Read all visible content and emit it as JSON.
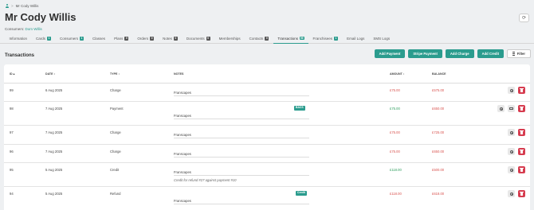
{
  "breadcrumb": {
    "separator": ">",
    "current": "Mr Cody Willis"
  },
  "page_title": "Mr Cody Willis",
  "consumers": {
    "label": "Consumers:",
    "link": "Dom Willis"
  },
  "tabs": [
    {
      "label": "Information",
      "badge": ""
    },
    {
      "label": "Cards",
      "badge": "1",
      "badge_color": "teal"
    },
    {
      "label": "Consumers",
      "badge": "1",
      "badge_color": "teal"
    },
    {
      "label": "Classes",
      "badge": ""
    },
    {
      "label": "Plans",
      "badge": "0"
    },
    {
      "label": "Orders",
      "badge": "0"
    },
    {
      "label": "Notes",
      "badge": "0"
    },
    {
      "label": "Documents",
      "badge": "0"
    },
    {
      "label": "Memberships",
      "badge": ""
    },
    {
      "label": "Contacts",
      "badge": "0"
    },
    {
      "label": "Transactions",
      "badge": "99",
      "badge_color": "teal",
      "active": true
    },
    {
      "label": "Franchisees",
      "badge": "1",
      "badge_color": "teal"
    },
    {
      "label": "Email Logs",
      "badge": ""
    },
    {
      "label": "SMS Logs",
      "badge": ""
    }
  ],
  "section_title": "Transactions",
  "actions": {
    "add_payment": "Add Payment",
    "stripe_payment": "Stripe Payment",
    "add_charge": "Add Charge",
    "add_credit": "Add Credit",
    "filter": "Filter"
  },
  "table": {
    "headers": {
      "id": "ID ▴",
      "date": "DATE ↕",
      "type": "TYPE ↕",
      "notes": "NOTES",
      "amount": "AMOUNT ↕",
      "balance": "BALANCE"
    },
    "rows": [
      {
        "id": "99",
        "date": "6 Aug 2025",
        "type": "Charge",
        "note": "Franscapes",
        "tag": "",
        "sub_note": "",
        "amount": "£75.00",
        "amount_color": "red",
        "balance": "£575.00",
        "has_receipt": false
      },
      {
        "id": "98",
        "date": "7 Aug 2025",
        "type": "Payment",
        "note": "Franscapes",
        "tag": "BACS",
        "sub_note": "",
        "amount": "£75.00",
        "amount_color": "green",
        "balance": "£650.00",
        "has_receipt": true
      },
      {
        "id": "97",
        "date": "7 Aug 2025",
        "type": "Charge",
        "note": "Franscapes",
        "tag": "",
        "sub_note": "",
        "amount": "£75.00",
        "amount_color": "red",
        "balance": "£725.00",
        "has_receipt": false
      },
      {
        "id": "96",
        "date": "7 Aug 2025",
        "type": "Charge",
        "note": "Franscapes",
        "tag": "",
        "sub_note": "",
        "amount": "£75.00",
        "amount_color": "red",
        "balance": "£650.00",
        "has_receipt": false
      },
      {
        "id": "95",
        "date": "5 Aug 2025",
        "type": "Credit",
        "note": "Franscapes",
        "tag": "",
        "sub_note": "Credit for refund #27 against payment #10",
        "amount": "£118.00",
        "amount_color": "green",
        "balance": "£500.00",
        "has_receipt": false
      },
      {
        "id": "94",
        "date": "5 Aug 2025",
        "type": "Refund",
        "note": "Franscapes",
        "tag": "Credit",
        "sub_note": "",
        "amount": "£118.00",
        "amount_color": "red",
        "balance": "£618.00",
        "has_receipt": false
      }
    ]
  },
  "colors": {
    "accent": "#2b9c8e",
    "danger": "#d63c4f",
    "negative": "#d9534f",
    "positive": "#2f9e5e"
  }
}
